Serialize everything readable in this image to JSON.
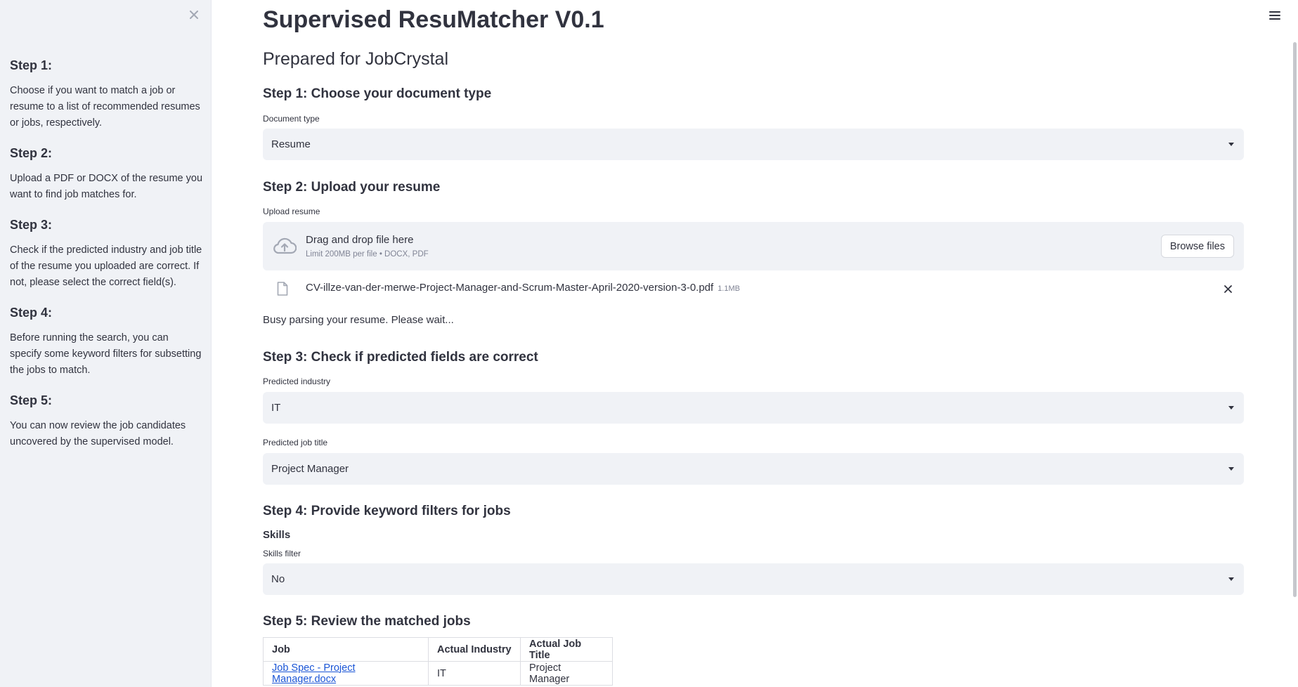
{
  "sidebar": {
    "steps": [
      {
        "title": "Step 1:",
        "text": "Choose if you want to match a job or resume to a list of recommended resumes or jobs, respectively."
      },
      {
        "title": "Step 2:",
        "text": "Upload a PDF or DOCX of the resume you want to find job matches for."
      },
      {
        "title": "Step 3:",
        "text": "Check if the predicted industry and job title of the resume you uploaded are correct. If not, please select the correct field(s)."
      },
      {
        "title": "Step 4:",
        "text": "Before running the search, you can specify some keyword filters for subsetting the jobs to match."
      },
      {
        "title": "Step 5:",
        "text": "You can now review the job candidates uncovered by the supervised model."
      }
    ]
  },
  "main": {
    "title": "Supervised ResuMatcher V0.1",
    "subtitle": "Prepared for JobCrystal",
    "step1": {
      "heading": "Step 1: Choose your document type",
      "label": "Document type",
      "value": "Resume"
    },
    "step2": {
      "heading": "Step 2: Upload your resume",
      "label": "Upload resume",
      "dropzone_text": "Drag and drop file here",
      "dropzone_limit": "Limit 200MB per file • DOCX, PDF",
      "browse_label": "Browse files",
      "file_name": "CV-illze-van-der-merwe-Project-Manager-and-Scrum-Master-April-2020-version-3-0.pdf",
      "file_size": "1.1MB",
      "status": "Busy parsing your resume. Please wait..."
    },
    "step3": {
      "heading": "Step 3: Check if predicted fields are correct",
      "industry_label": "Predicted industry",
      "industry_value": "IT",
      "job_title_label": "Predicted job title",
      "job_title_value": "Project Manager"
    },
    "step4": {
      "heading": "Step 4: Provide keyword filters for jobs",
      "skills_heading": "Skills",
      "skills_label": "Skills filter",
      "skills_value": "No"
    },
    "step5": {
      "heading": "Step 5: Review the matched jobs",
      "table": {
        "headers": [
          "Job",
          "Actual Industry",
          "Actual Job Title"
        ],
        "rows": [
          [
            "Job Spec - Project Manager.docx",
            "IT",
            "Project Manager"
          ]
        ]
      }
    }
  },
  "colors": {
    "sidebar_bg": "#f0f2f6",
    "input_bg": "#f0f2f6",
    "text": "#31333f",
    "link": "#1a55d6"
  }
}
